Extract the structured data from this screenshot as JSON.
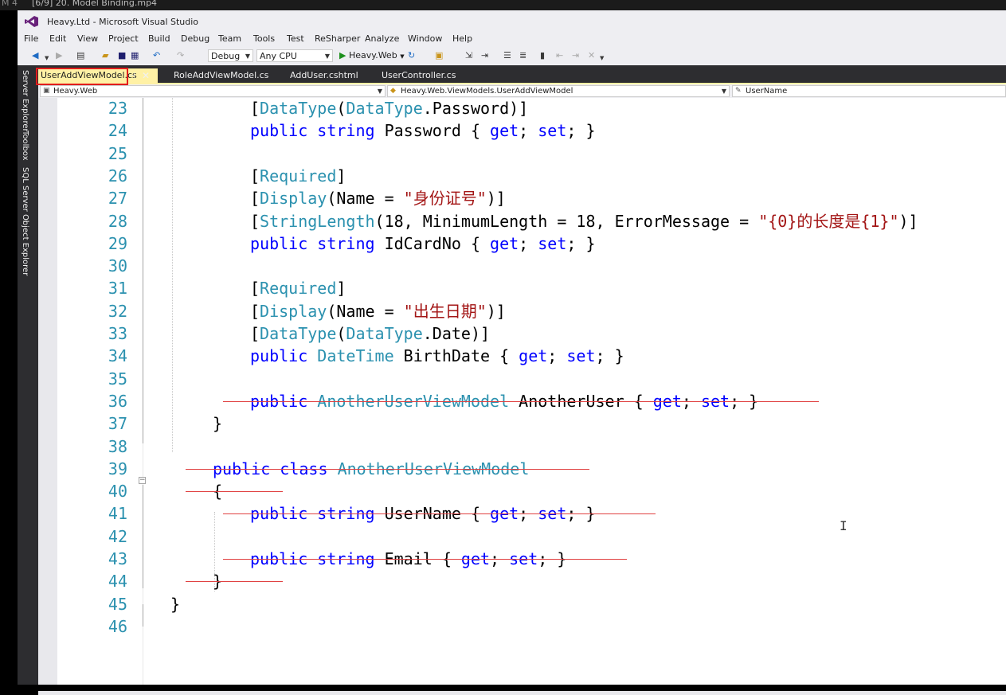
{
  "media_bar": {
    "left_text": "M 4",
    "title": "[6/9] 20. Model Binding.mp4"
  },
  "window": {
    "title": "Heavy.Ltd - Microsoft Visual Studio"
  },
  "menu": [
    "File",
    "Edit",
    "View",
    "Project",
    "Build",
    "Debug",
    "Team",
    "Tools",
    "Test",
    "ReSharper",
    "Analyze",
    "Window",
    "Help"
  ],
  "toolbar": {
    "configuration": "Debug",
    "platform": "Any CPU",
    "run_target": "Heavy.Web"
  },
  "side_tabs": [
    "Server Explorer",
    "Toolbox",
    "SQL Server Object Explorer"
  ],
  "tabs": [
    {
      "label": "UserAddViewModel.cs",
      "active": true
    },
    {
      "label": "RoleAddViewModel.cs",
      "active": false
    },
    {
      "label": "AddUser.cshtml",
      "active": false
    },
    {
      "label": "UserController.cs",
      "active": false
    }
  ],
  "nav": {
    "project": "Heavy.Web",
    "type": "Heavy.Web.ViewModels.UserAddViewModel",
    "member": "UserName"
  },
  "colors": {
    "keyword": "#0000ff",
    "type": "#2b91af",
    "string": "#a31515",
    "active_tab": "#fff1a5",
    "highlight_box": "#e21d1d",
    "strike": "#e04040"
  },
  "code": [
    {
      "n": "23",
      "indent": 4,
      "parts": [
        [
          "p",
          "["
        ],
        [
          "ty",
          "DataType"
        ],
        [
          "p",
          "("
        ],
        [
          "ty",
          "DataType"
        ],
        [
          "p",
          ".Password)]"
        ]
      ]
    },
    {
      "n": "24",
      "indent": 4,
      "parts": [
        [
          "kw",
          "public"
        ],
        [
          "p",
          " "
        ],
        [
          "kw",
          "string"
        ],
        [
          "p",
          " Password { "
        ],
        [
          "kw",
          "get"
        ],
        [
          "p",
          "; "
        ],
        [
          "kw",
          "set"
        ],
        [
          "p",
          "; }"
        ]
      ]
    },
    {
      "n": "25",
      "indent": 4,
      "parts": []
    },
    {
      "n": "26",
      "indent": 4,
      "parts": [
        [
          "p",
          "["
        ],
        [
          "ty",
          "Required"
        ],
        [
          "p",
          "]"
        ]
      ]
    },
    {
      "n": "27",
      "indent": 4,
      "parts": [
        [
          "p",
          "["
        ],
        [
          "ty",
          "Display"
        ],
        [
          "p",
          "(Name = "
        ],
        [
          "st",
          "\"身份证号\""
        ],
        [
          "p",
          ")]"
        ]
      ]
    },
    {
      "n": "28",
      "indent": 4,
      "parts": [
        [
          "p",
          "["
        ],
        [
          "ty",
          "StringLength"
        ],
        [
          "p",
          "(18, MinimumLength = 18, ErrorMessage = "
        ],
        [
          "st",
          "\"{0}的长度是{1}\""
        ],
        [
          "p",
          ")]"
        ]
      ]
    },
    {
      "n": "29",
      "indent": 4,
      "parts": [
        [
          "kw",
          "public"
        ],
        [
          "p",
          " "
        ],
        [
          "kw",
          "string"
        ],
        [
          "p",
          " IdCardNo { "
        ],
        [
          "kw",
          "get"
        ],
        [
          "p",
          "; "
        ],
        [
          "kw",
          "set"
        ],
        [
          "p",
          "; }"
        ]
      ]
    },
    {
      "n": "30",
      "indent": 4,
      "parts": []
    },
    {
      "n": "31",
      "indent": 4,
      "parts": [
        [
          "p",
          "["
        ],
        [
          "ty",
          "Required"
        ],
        [
          "p",
          "]"
        ]
      ]
    },
    {
      "n": "32",
      "indent": 4,
      "parts": [
        [
          "p",
          "["
        ],
        [
          "ty",
          "Display"
        ],
        [
          "p",
          "(Name = "
        ],
        [
          "st",
          "\"出生日期\""
        ],
        [
          "p",
          ")]"
        ]
      ]
    },
    {
      "n": "33",
      "indent": 4,
      "parts": [
        [
          "p",
          "["
        ],
        [
          "ty",
          "DataType"
        ],
        [
          "p",
          "("
        ],
        [
          "ty",
          "DataType"
        ],
        [
          "p",
          ".Date)]"
        ]
      ]
    },
    {
      "n": "34",
      "indent": 4,
      "parts": [
        [
          "kw",
          "public"
        ],
        [
          "p",
          " "
        ],
        [
          "ty",
          "DateTime"
        ],
        [
          "p",
          " BirthDate { "
        ],
        [
          "kw",
          "get"
        ],
        [
          "p",
          "; "
        ],
        [
          "kw",
          "set"
        ],
        [
          "p",
          "; }"
        ]
      ]
    },
    {
      "n": "35",
      "indent": 4,
      "parts": []
    },
    {
      "n": "36",
      "indent": 4,
      "struck": true,
      "parts": [
        [
          "kw",
          "public"
        ],
        [
          "p",
          " "
        ],
        [
          "ty",
          "AnotherUserViewModel"
        ],
        [
          "p",
          " AnotherUser { "
        ],
        [
          "kw",
          "get"
        ],
        [
          "p",
          "; "
        ],
        [
          "kw",
          "set"
        ],
        [
          "p",
          "; }"
        ]
      ]
    },
    {
      "n": "37",
      "indent": 2,
      "parts": [
        [
          "p",
          "}"
        ]
      ]
    },
    {
      "n": "38",
      "indent": 2,
      "parts": []
    },
    {
      "n": "39",
      "indent": 2,
      "struck": true,
      "parts": [
        [
          "kw",
          "public"
        ],
        [
          "p",
          " "
        ],
        [
          "kw",
          "class"
        ],
        [
          "p",
          " "
        ],
        [
          "ty",
          "AnotherUserViewModel"
        ]
      ]
    },
    {
      "n": "40",
      "indent": 2,
      "struck": true,
      "parts": [
        [
          "p",
          "{"
        ]
      ]
    },
    {
      "n": "41",
      "indent": 4,
      "struck": true,
      "parts": [
        [
          "kw",
          "public"
        ],
        [
          "p",
          " "
        ],
        [
          "kw",
          "string"
        ],
        [
          "p",
          " UserName { "
        ],
        [
          "kw",
          "get"
        ],
        [
          "p",
          "; "
        ],
        [
          "kw",
          "set"
        ],
        [
          "p",
          "; }"
        ]
      ]
    },
    {
      "n": "42",
      "indent": 4,
      "parts": []
    },
    {
      "n": "43",
      "indent": 4,
      "struck": true,
      "parts": [
        [
          "kw",
          "public"
        ],
        [
          "p",
          " "
        ],
        [
          "kw",
          "string"
        ],
        [
          "p",
          " Email { "
        ],
        [
          "kw",
          "get"
        ],
        [
          "p",
          "; "
        ],
        [
          "kw",
          "set"
        ],
        [
          "p",
          "; }"
        ]
      ]
    },
    {
      "n": "44",
      "indent": 2,
      "struck": true,
      "parts": [
        [
          "p",
          "}"
        ]
      ]
    },
    {
      "n": "45",
      "indent": 0,
      "parts": [
        [
          "p",
          "}"
        ]
      ]
    },
    {
      "n": "46",
      "indent": 0,
      "parts": []
    }
  ]
}
